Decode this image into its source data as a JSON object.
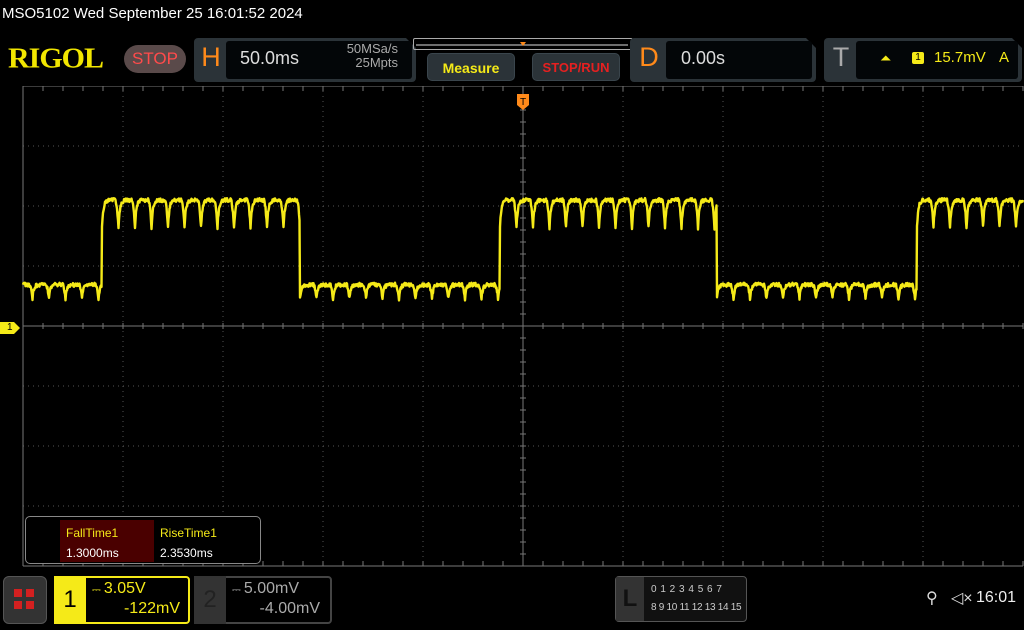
{
  "title": "MSO5102  Wed September 25 16:01:52 2024",
  "logo": "RIGOL",
  "run_state": "STOP",
  "horizontal": {
    "letter": "H",
    "timebase": "50.0ms",
    "sample_rate": "50MSa/s",
    "memory_depth": "25Mpts"
  },
  "buttons": {
    "measure": "Measure",
    "stop_run": "STOP/RUN"
  },
  "delay": {
    "letter": "D",
    "value": "0.00s"
  },
  "trigger": {
    "letter": "T",
    "slope_icon": "rising-edge-icon",
    "slope_glyph": "⏶",
    "source": "1",
    "level": "15.7mV",
    "mode": "A"
  },
  "channel_marker": "1",
  "measurements": [
    {
      "name": "FallTime1",
      "value": "1.3000ms"
    },
    {
      "name": "RiseTime1",
      "value": "2.3530ms"
    }
  ],
  "channels": [
    {
      "num": "1",
      "coupling_icon": "dc-icon",
      "scale": "3.05V",
      "offset": "-122mV",
      "color": "#f5ea18",
      "active": true
    },
    {
      "num": "2",
      "coupling_icon": "dc-icon",
      "scale": "5.00mV",
      "offset": "-4.00mV",
      "color": "#aaaaaa",
      "active": false
    }
  ],
  "logic": {
    "letter": "L",
    "row1": "0 1 2 3  4 5 6 7",
    "row2": "8 9 10 11 12 13 14 15"
  },
  "status": {
    "usb_icon": "usb-icon",
    "mute_icon": "speaker-muted-icon",
    "time": "16:01"
  },
  "colors": {
    "ch1": "#f5ea18",
    "accent": "#ff8a1a",
    "stop": "#ff4b4b"
  },
  "chart_data": {
    "type": "line",
    "xlabel": "",
    "ylabel": "",
    "xlim_ms": [
      -250,
      250
    ],
    "ylim_V": [
      -12.2,
      12.2
    ],
    "x_divisions": 10,
    "y_divisions": 8,
    "grid": true,
    "series": [
      {
        "waveform": "square with ripple",
        "high_V": 6.4,
        "low_V": 2.1,
        "ripple_period_ms": 8.25,
        "high_dip_V": 1.4,
        "low_dip_V": 0.7,
        "edges_ms": [
          {
            "t": -210.5,
            "dir": "rise"
          },
          {
            "t": -111.5,
            "dir": "fall"
          },
          {
            "t": -11.5,
            "dir": "rise"
          },
          {
            "t": 97,
            "dir": "fall"
          },
          {
            "t": 197,
            "dir": "rise"
          }
        ],
        "initial_state": "low"
      }
    ]
  }
}
